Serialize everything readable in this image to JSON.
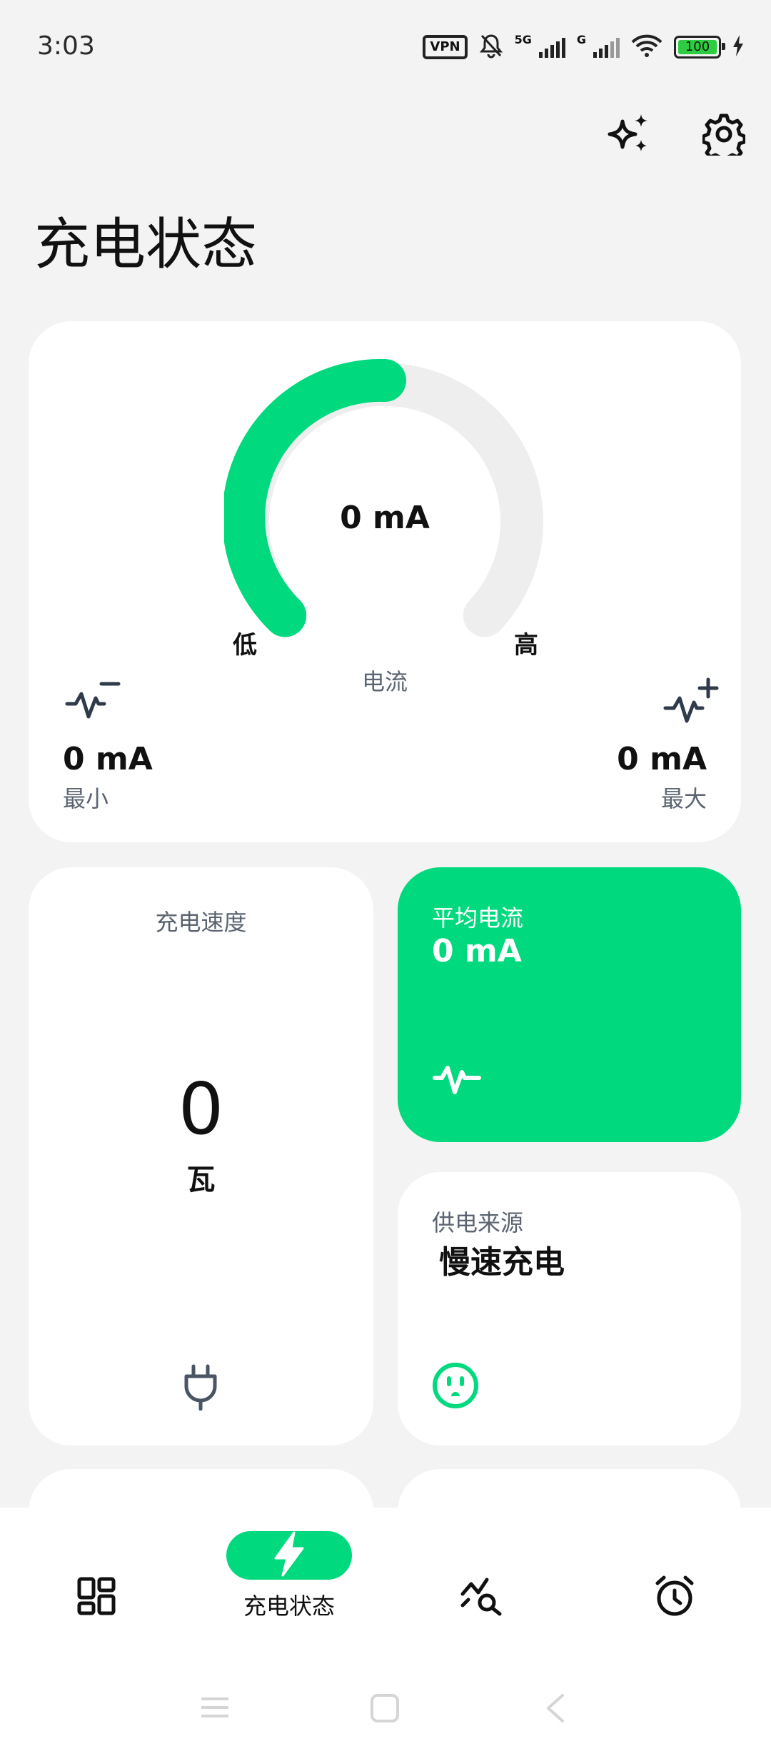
{
  "status_bar": {
    "time": "3:03",
    "vpn": "VPN",
    "net1": "5G",
    "net2": "G",
    "battery": "100"
  },
  "header": {
    "title": "充电状态",
    "icons": [
      "sparkles-icon",
      "settings-gear-icon"
    ]
  },
  "gauge": {
    "value": "0 mA",
    "low_label": "低",
    "high_label": "高",
    "metric": "电流",
    "level": 0.5,
    "accent": "#00D97E"
  },
  "min": {
    "value": "0 mA",
    "label": "最小"
  },
  "max": {
    "value": "0 mA",
    "label": "最大"
  },
  "charge_speed": {
    "title": "充电速度",
    "value": "0",
    "unit": "瓦"
  },
  "avg_current": {
    "title": "平均电流",
    "value": "0 mA"
  },
  "power_source": {
    "title": "供电来源",
    "value": "慢速充电"
  },
  "bottom_nav": {
    "items": [
      {
        "icon": "dashboard-grid-icon",
        "label": ""
      },
      {
        "icon": "bolt-icon",
        "label": "充电状态",
        "active": true
      },
      {
        "icon": "chart-search-icon",
        "label": ""
      },
      {
        "icon": "alarm-clock-icon",
        "label": ""
      }
    ]
  },
  "colors": {
    "accent": "#00D97E",
    "background": "#F3F3F3",
    "card": "#FFFFFF"
  }
}
